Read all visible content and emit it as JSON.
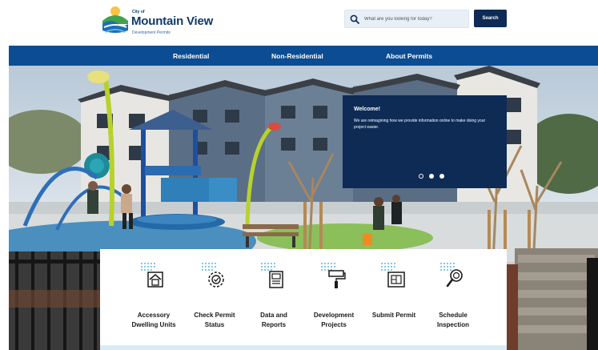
{
  "header": {
    "logo": {
      "city_prefix": "City of",
      "city_name": "Mountain View",
      "subtitle": "Development Permits"
    },
    "search": {
      "placeholder": "What are you looking for today?",
      "value": "",
      "button_label": "Search"
    }
  },
  "nav": {
    "items": [
      {
        "label": "Residential"
      },
      {
        "label": "Non-Residential"
      },
      {
        "label": "About Permits"
      }
    ]
  },
  "hero": {
    "welcome": {
      "title": "Welcome!",
      "text": "We are reimagining how we provide information online to make doing your project easier."
    },
    "carousel": {
      "slide_count": 3,
      "active_index": 0
    }
  },
  "services": [
    {
      "line1": "Accessory",
      "line2": "Dwelling Units",
      "icon": "adu-house-icon"
    },
    {
      "line1": "Check Permit",
      "line2": "Status",
      "icon": "gear-check-icon"
    },
    {
      "line1": "Data and",
      "line2": "Reports",
      "icon": "report-document-icon"
    },
    {
      "line1": "Development",
      "line2": "Projects",
      "icon": "paint-roller-icon"
    },
    {
      "line1": "Submit Permit",
      "line2": "",
      "icon": "blueprint-icon"
    },
    {
      "line1": "Schedule",
      "line2": "Inspection",
      "icon": "magnifier-icon"
    }
  ],
  "colors": {
    "navy": "#0d2b55",
    "nav_blue": "#0b4c92",
    "accent_light_blue": "#5ab4e5",
    "search_bg": "#e9eff6"
  }
}
